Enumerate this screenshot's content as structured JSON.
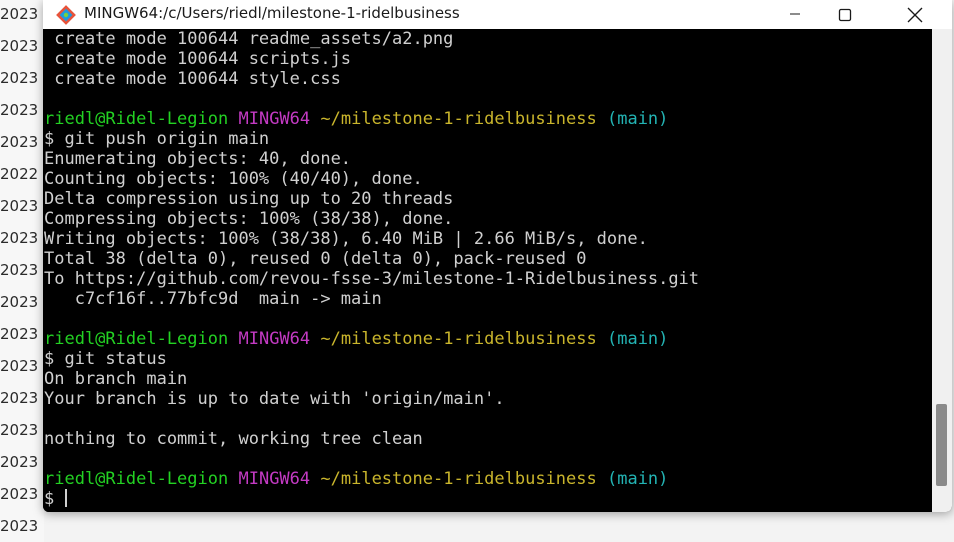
{
  "background": {
    "years": [
      "2023",
      "2023",
      "2023",
      "2023",
      "2023",
      "2022",
      "2023",
      "2023",
      "2023",
      "2023",
      "2023",
      "2023",
      "2023",
      "2023",
      "2023",
      "2023",
      "2023"
    ]
  },
  "window": {
    "title": "MINGW64:/c/Users/riedl/milestone-1-ridelbusiness",
    "minimize_icon": "minimize-icon",
    "maximize_icon": "maximize-icon",
    "close_icon": "close-icon"
  },
  "terminal": {
    "lines": [
      {
        "type": "text",
        "text": " create mode 100644 readme_assets/a2.png"
      },
      {
        "type": "text",
        "text": " create mode 100644 scripts.js"
      },
      {
        "type": "text",
        "text": " create mode 100644 style.css"
      },
      {
        "type": "blank",
        "text": ""
      },
      {
        "type": "prompt",
        "user": "riedl@Ridel-Legion",
        "shell": "MINGW64",
        "path": "~/milestone-1-ridelbusiness",
        "branch": "(main)"
      },
      {
        "type": "text",
        "text": "$ git push origin main"
      },
      {
        "type": "text",
        "text": "Enumerating objects: 40, done."
      },
      {
        "type": "text",
        "text": "Counting objects: 100% (40/40), done."
      },
      {
        "type": "text",
        "text": "Delta compression using up to 20 threads"
      },
      {
        "type": "text",
        "text": "Compressing objects: 100% (38/38), done."
      },
      {
        "type": "text",
        "text": "Writing objects: 100% (38/38), 6.40 MiB | 2.66 MiB/s, done."
      },
      {
        "type": "text",
        "text": "Total 38 (delta 0), reused 0 (delta 0), pack-reused 0"
      },
      {
        "type": "text",
        "text": "To https://github.com/revou-fsse-3/milestone-1-Ridelbusiness.git"
      },
      {
        "type": "text",
        "text": "   c7cf16f..77bfc9d  main -> main"
      },
      {
        "type": "blank",
        "text": ""
      },
      {
        "type": "prompt",
        "user": "riedl@Ridel-Legion",
        "shell": "MINGW64",
        "path": "~/milestone-1-ridelbusiness",
        "branch": "(main)"
      },
      {
        "type": "text",
        "text": "$ git status"
      },
      {
        "type": "text",
        "text": "On branch main"
      },
      {
        "type": "text",
        "text": "Your branch is up to date with 'origin/main'."
      },
      {
        "type": "blank",
        "text": ""
      },
      {
        "type": "text",
        "text": "nothing to commit, working tree clean"
      },
      {
        "type": "blank",
        "text": ""
      },
      {
        "type": "prompt",
        "user": "riedl@Ridel-Legion",
        "shell": "MINGW64",
        "path": "~/milestone-1-ridelbusiness",
        "branch": "(main)"
      },
      {
        "type": "input",
        "text": "$ "
      }
    ]
  },
  "colors": {
    "user": "#23d123",
    "shell": "#c33ac3",
    "path": "#c9b52c",
    "branch": "#23b4b4",
    "text": "#d0d0d0",
    "background": "#000000"
  }
}
